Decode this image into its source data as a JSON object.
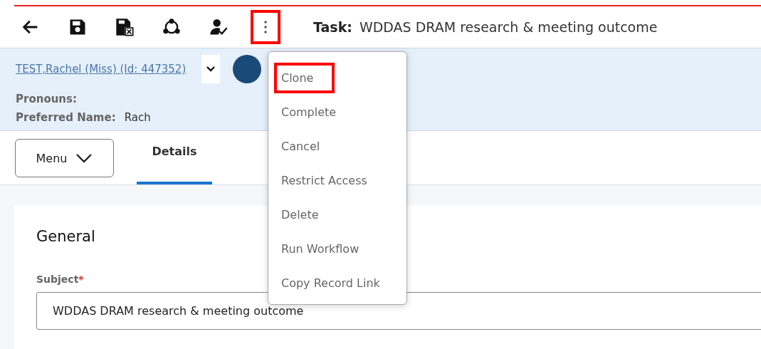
{
  "toolbar": {
    "items": [
      {
        "kind": "back",
        "highlighted": false
      },
      {
        "kind": "save",
        "highlighted": false
      },
      {
        "kind": "save-close",
        "highlighted": false
      },
      {
        "kind": "share",
        "highlighted": false
      },
      {
        "kind": "assign",
        "highlighted": false
      },
      {
        "kind": "more",
        "highlighted": true
      }
    ],
    "title_label": "Task:",
    "title": "WDDAS DRAM research & meeting outcome"
  },
  "banner": {
    "person_link": "TEST,Rachel (Miss) (Id: 447352)",
    "fields": [
      {
        "label": "Pronouns:"
      },
      {
        "label": "Preferred Name:",
        "value": "Rach"
      }
    ]
  },
  "menu_button": {
    "label": "Menu"
  },
  "tabs": [
    {
      "label": "Details",
      "selected": true
    }
  ],
  "section": {
    "heading": "General",
    "subject_label": "Subject",
    "required_mark": "*",
    "subject_value": "WDDAS DRAM research & meeting outcome"
  },
  "dropdown": {
    "items": [
      {
        "label": "Clone",
        "highlighted": true
      },
      {
        "label": "Complete",
        "highlighted": false
      },
      {
        "label": "Cancel",
        "highlighted": false
      },
      {
        "label": "Restrict Access",
        "highlighted": false
      },
      {
        "label": "Delete",
        "highlighted": false
      },
      {
        "label": "Run Workflow",
        "highlighted": false
      },
      {
        "label": "Copy Record Link",
        "highlighted": false
      }
    ]
  }
}
